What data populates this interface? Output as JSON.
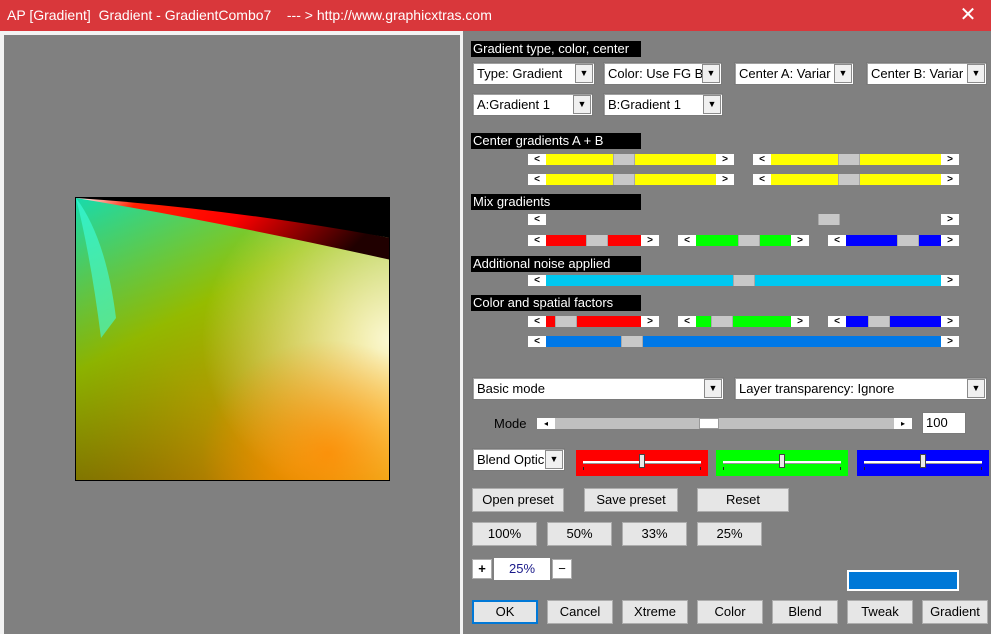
{
  "window": {
    "title": "AP [Gradient]  Gradient - GradientCombo7    --- > http://www.graphicxtras.com",
    "close_glyph": "✕"
  },
  "sections": {
    "type": "Gradient type, color, center",
    "center": "Center gradients A + B",
    "mix": "Mix gradients",
    "noise": "Additional noise applied",
    "factors": "Color and spatial factors"
  },
  "combos": {
    "type": "Type: Gradient",
    "color": "Color: Use FG B",
    "center_a": "Center A: Variar",
    "center_b": "Center B: Variar",
    "grad_a": "A:Gradient 1",
    "grad_b": "B:Gradient 1",
    "mode": "Basic mode",
    "transparency": "Layer transparency: Ignore",
    "blend": "Blend Optic"
  },
  "mode_slider": {
    "label": "Mode",
    "value": "100",
    "level": 0.45
  },
  "colors": {
    "yellow": "#ffff00",
    "red": "#ff0000",
    "green": "#00ff00",
    "blue": "#0000ff",
    "cyan": "#00c8f0",
    "sky": "#0078e6",
    "swatch": "#0078d7"
  },
  "sliders": {
    "center_a1": 0.45,
    "center_a2": 0.45,
    "center_b1": 0.45,
    "center_b2": 0.45,
    "mix_gray": 0.73,
    "mix_red": 0.55,
    "mix_green": 0.58,
    "mix_blue": 0.7,
    "noise": 0.5,
    "factor_red": 0.12,
    "factor_green": 0.2,
    "factor_blue": 0.3,
    "factor_sky": 0.2
  },
  "blend_sliders": {
    "red": 0.5,
    "green": 0.5,
    "blue": 0.5
  },
  "buttons": {
    "open": "Open preset",
    "save": "Save preset",
    "reset": "Reset",
    "z100": "100%",
    "z50": "50%",
    "z33": "33%",
    "z25": "25%",
    "ok": "OK",
    "cancel": "Cancel",
    "xtreme": "Xtreme",
    "color": "Color",
    "blend": "Blend",
    "tweak": "Tweak",
    "gradient": "Gradient"
  },
  "zoom": {
    "plus": "+",
    "minus": "−",
    "value": "25%"
  }
}
